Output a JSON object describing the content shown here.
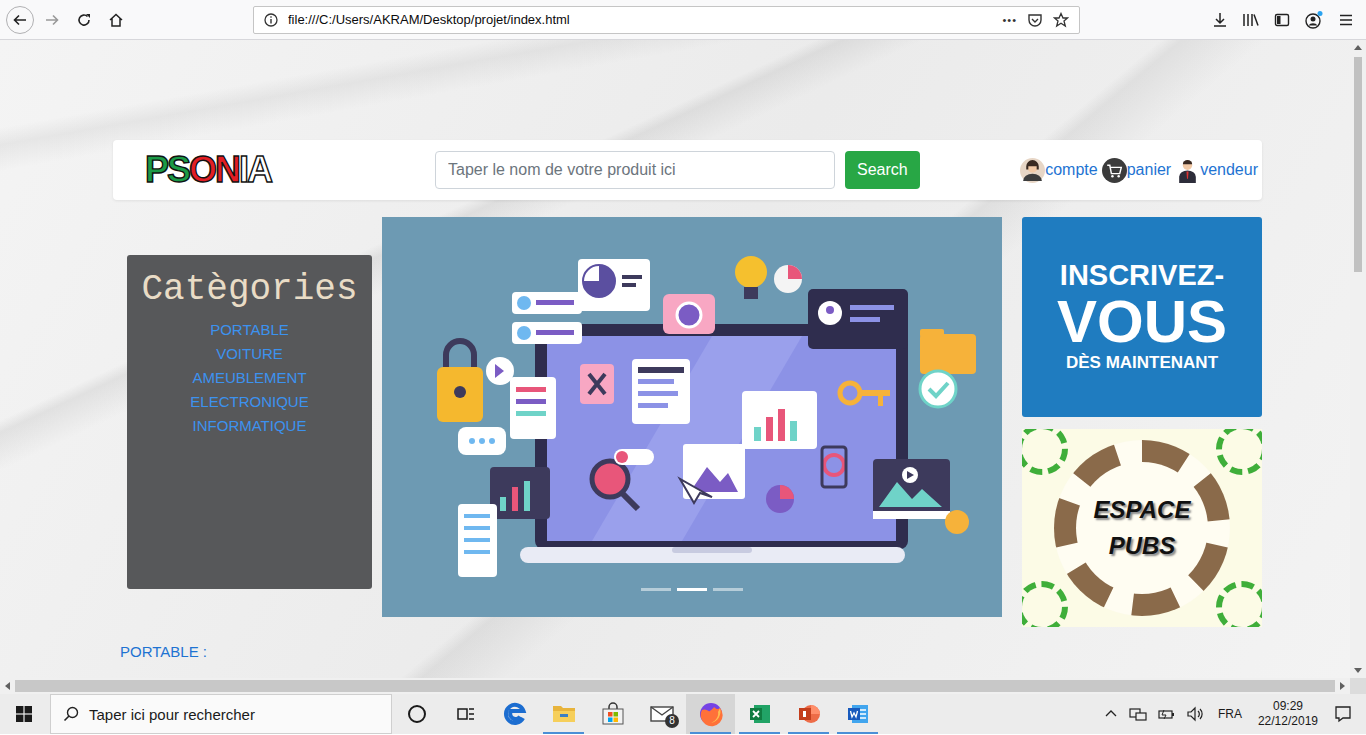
{
  "browser": {
    "url": "file:///C:/Users/AKRAM/Desktop/projet/index.html",
    "page_actions": "•••"
  },
  "header": {
    "logo": [
      {
        "text": "PS",
        "color": "#1b9a47"
      },
      {
        "text": "ON",
        "color": "#e31e24"
      },
      {
        "text": "IA",
        "color": "#ffffff"
      }
    ],
    "search": {
      "placeholder": "Taper le nom de votre produit ici",
      "button": "Search"
    },
    "links": [
      {
        "label": "compte",
        "kind": "user"
      },
      {
        "label": "panier",
        "kind": "cart"
      },
      {
        "label": "vendeur",
        "kind": "seller"
      }
    ]
  },
  "categories": {
    "title": "Catègories",
    "items": [
      "PORTABLE",
      "VOITURE",
      "AMEUBLEMENT",
      "ELECTRONIQUE",
      "INFORMATIQUE"
    ]
  },
  "carousel": {
    "slides": [
      {
        "selected": false
      },
      {
        "selected": true
      },
      {
        "selected": false
      }
    ]
  },
  "banners": {
    "signup": [
      "INSCRIVEZ-",
      "VOUS",
      "DÈS MAINTENANT"
    ],
    "ads": [
      "ESPACE",
      "PUBS"
    ]
  },
  "section": {
    "title": "PORTABLE :"
  },
  "taskbar": {
    "search_placeholder": "Taper ici pour rechercher",
    "apps": [
      {
        "kind": "cortana",
        "running": false,
        "selected": false
      },
      {
        "kind": "taskview",
        "running": false,
        "selected": false
      },
      {
        "kind": "edge",
        "running": false,
        "selected": false
      },
      {
        "kind": "explorer",
        "running": true,
        "selected": false
      },
      {
        "kind": "store",
        "running": false,
        "selected": false
      },
      {
        "kind": "mail",
        "running": false,
        "selected": false,
        "badge": "8"
      },
      {
        "kind": "firefox",
        "running": true,
        "selected": true
      },
      {
        "kind": "excel",
        "running": true,
        "selected": false
      },
      {
        "kind": "powerpoint",
        "running": true,
        "selected": false
      },
      {
        "kind": "word",
        "running": true,
        "selected": false
      }
    ],
    "tray": {
      "lang": "FRA",
      "time": "09:29",
      "date": "22/12/2019"
    }
  }
}
